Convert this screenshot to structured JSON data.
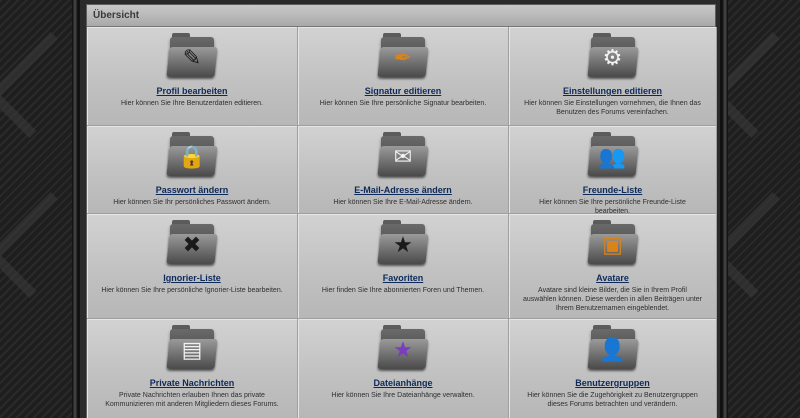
{
  "panel": {
    "header": "Übersicht"
  },
  "items": [
    {
      "title": "Profil bearbeiten",
      "desc": "Hier können Sie Ihre Benutzerdaten editieren.",
      "icon": "✎",
      "icon_name": "profile-edit-icon",
      "tone": ""
    },
    {
      "title": "Signatur editieren",
      "desc": "Hier können Sie Ihre persönliche Signatur bearbeiten.",
      "icon": "✒",
      "icon_name": "signature-pen-icon",
      "tone": "orange"
    },
    {
      "title": "Einstellungen editieren",
      "desc": "Hier können Sie Einstellungen vornehmen, die Ihnen das Benutzen des Forums vereinfachen.",
      "icon": "⚙",
      "icon_name": "settings-gear-icon",
      "tone": "light"
    },
    {
      "title": "Passwort ändern",
      "desc": "Hier können Sie Ihr persönliches Passwort ändern.",
      "icon": "🔒",
      "icon_name": "padlock-icon",
      "tone": ""
    },
    {
      "title": "E-Mail-Adresse ändern",
      "desc": "Hier können Sie Ihre E-Mail-Adresse ändern.",
      "icon": "✉",
      "icon_name": "envelope-icon",
      "tone": "light"
    },
    {
      "title": "Freunde-Liste",
      "desc": "Hier können Sie Ihre persönliche Freunde-Liste bearbeiten.",
      "icon": "👥",
      "icon_name": "friends-icon",
      "tone": ""
    },
    {
      "title": "Ignorier-Liste",
      "desc": "Hier können Sie Ihre persönliche Ignorier-Liste bearbeiten.",
      "icon": "✖",
      "icon_name": "ignore-x-icon",
      "tone": ""
    },
    {
      "title": "Favoriten",
      "desc": "Hier finden Sie Ihre abonnierten Foren und Themen.",
      "icon": "★",
      "icon_name": "star-icon",
      "tone": ""
    },
    {
      "title": "Avatare",
      "desc": "Avatare sind kleine Bilder, die Sie in Ihrem Profil auswählen können. Diese werden in allen Beiträgen unter Ihrem Benutzernamen eingeblendet.",
      "icon": "▣",
      "icon_name": "avatar-image-icon",
      "tone": "orange"
    },
    {
      "title": "Private Nachrichten",
      "desc": "Private Nachrichten erlauben Ihnen das private Kommunizieren mit anderen Mitgliedern dieses Forums.",
      "icon": "▤",
      "icon_name": "private-messages-icon",
      "tone": "light"
    },
    {
      "title": "Dateianhänge",
      "desc": "Hier können Sie Ihre Dateianhänge verwalten.",
      "icon": "★",
      "icon_name": "film-attachment-icon",
      "tone": "purple"
    },
    {
      "title": "Benutzergruppen",
      "desc": "Hier können Sie die Zugehörigkeit zu Benutzergruppen dieses Forums betrachten und verändern.",
      "icon": "👤",
      "icon_name": "user-group-icon",
      "tone": ""
    }
  ]
}
